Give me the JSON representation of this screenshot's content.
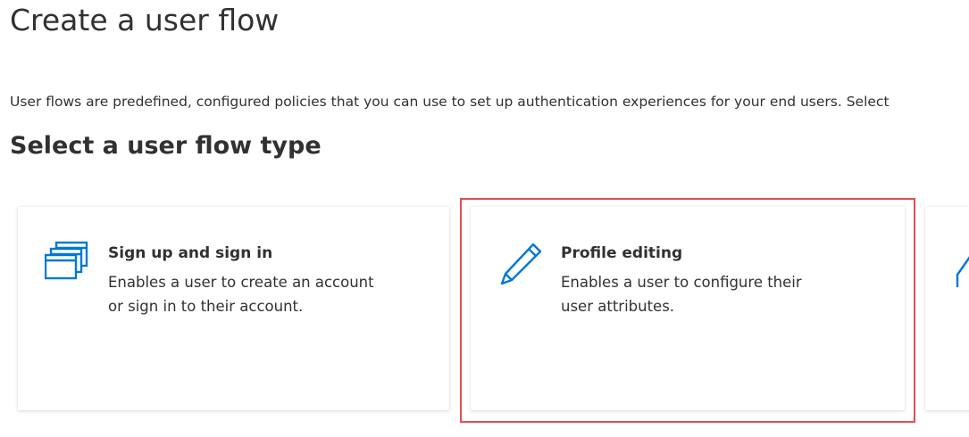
{
  "page": {
    "title": "Create a user flow",
    "description": "User flows are predefined, configured policies that you can use to set up authentication experiences for your end users. Select",
    "section_title": "Select a user flow type"
  },
  "cards": [
    {
      "title": "Sign up and sign in",
      "description_line1": "Enables a user to create an account",
      "description_line2": "or sign in to their account.",
      "icon": "windows-icon"
    },
    {
      "title": "Profile editing",
      "description_line1": "Enables a user to configure their",
      "description_line2": "user attributes.",
      "icon": "pencil-icon",
      "highlighted": true
    },
    {
      "icon": "partial-icon"
    }
  ],
  "colors": {
    "accent": "#0078d4",
    "text": "#323130",
    "highlight": "#e34e4e"
  }
}
